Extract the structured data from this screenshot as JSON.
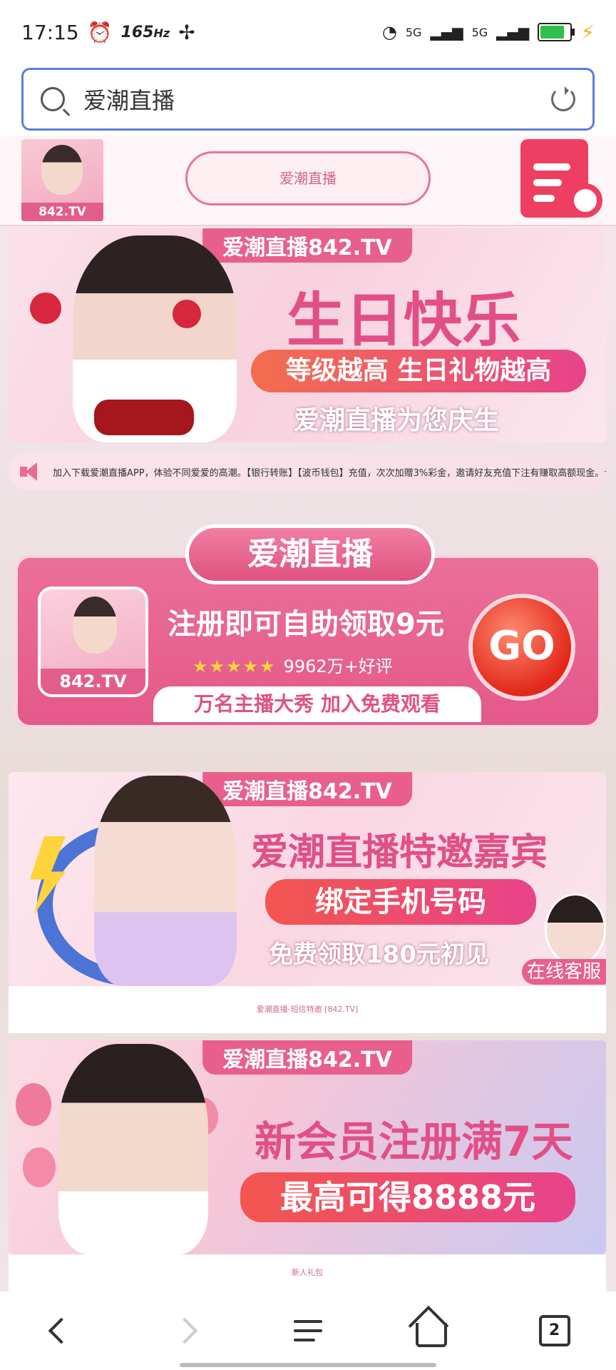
{
  "status_bar": {
    "time": "17:15",
    "refresh_rate": "165",
    "refresh_unit": "Hz",
    "network_1": "5G",
    "network_2": "5G"
  },
  "search": {
    "query": "爱潮直播"
  },
  "header": {
    "logo_text": "842.TV",
    "pill_button_label": "爱潮直播"
  },
  "banner_birthday": {
    "tag": "爱潮直播842.TV",
    "headline": "生日快乐",
    "ribbon": "等级越高 生日礼物越高",
    "subline": "爱潮直播为您庆生"
  },
  "marquee": {
    "text": "加入下载爱潮直播APP，体验不同爱爱的高潮。【银行转账】【波币钱包】充值，次次加赠3%彩金，邀请好友充值下注有赚取高额现金。认准永久官网爱"
  },
  "promo": {
    "title": "爱潮直播",
    "icon_text": "842.TV",
    "main": "注册即可自助领取9元",
    "stars": "★★★★★",
    "rating": "9962万+好评",
    "footer": "万名主播大秀 加入免费观看",
    "go_label": "GO"
  },
  "banner_guest": {
    "tag": "爱潮直播842.TV",
    "headline": "爱潮直播特邀嘉宾",
    "ribbon": "绑定手机号码",
    "subline": "免费领取180元初见",
    "service_label": "在线客服",
    "caption": "爱潮直播-短信特邀 [842.TV]"
  },
  "banner_member": {
    "tag": "爱潮直播842.TV",
    "headline": "新会员注册满7天",
    "ribbon": "最高可得8888元",
    "caption": "新人礼包"
  },
  "nav": {
    "tabs_count": "2"
  }
}
